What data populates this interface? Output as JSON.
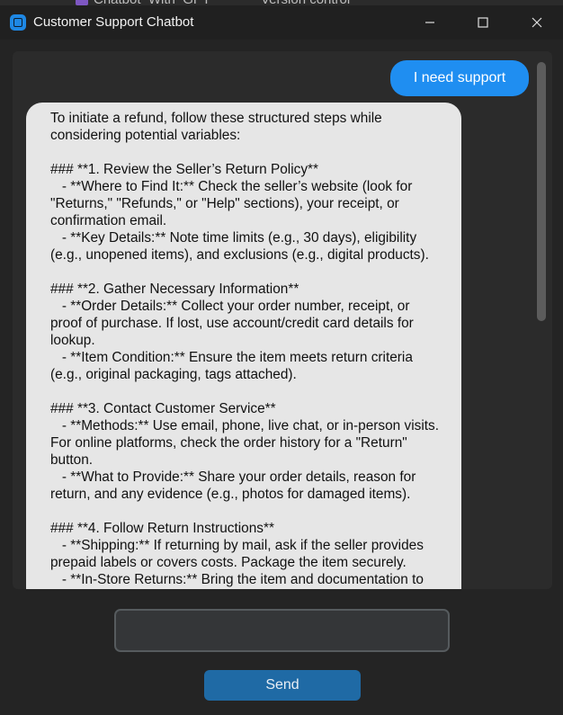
{
  "background_window": {
    "fragment_left": "Chatbot_With_GPT",
    "fragment_right": "Version control"
  },
  "window": {
    "title": "Customer Support Chatbot",
    "icon": "app-window-icon",
    "controls": {
      "minimize_icon": "minimize-icon",
      "maximize_icon": "maximize-icon",
      "close_icon": "close-icon"
    }
  },
  "chat": {
    "user_message": "I need support",
    "bot_message": "To initiate a refund, follow these structured steps while considering potential variables:\n\n### **1. Review the Seller’s Return Policy**\n   - **Where to Find It:** Check the seller’s website (look for \"Returns,\" \"Refunds,\" or \"Help\" sections), your receipt, or confirmation email.\n   - **Key Details:** Note time limits (e.g., 30 days), eligibility (e.g., unopened items), and exclusions (e.g., digital products).\n\n### **2. Gather Necessary Information**\n   - **Order Details:** Collect your order number, receipt, or proof of purchase. If lost, use account/credit card details for lookup.\n   - **Item Condition:** Ensure the item meets return criteria (e.g., original packaging, tags attached).\n\n### **3. Contact Customer Service**\n   - **Methods:** Use email, phone, live chat, or in-person visits. For online platforms, check the order history for a \"Return\" button.\n   - **What to Provide:** Share your order details, reason for return, and any evidence (e.g., photos for damaged items).\n\n### **4. Follow Return Instructions**\n   - **Shipping:** If returning by mail, ask if the seller provides prepaid labels or covers costs. Package the item securely.\n   - **In-Store Returns:** Bring the item and documentation to"
  },
  "input": {
    "value": "",
    "placeholder": ""
  },
  "send_button": {
    "label": "Send"
  },
  "colors": {
    "user_bubble": "#1f8ef1",
    "bot_bubble": "#e6e6e6",
    "send_button": "#1f6aa5",
    "window_bg": "#242424",
    "chat_bg": "#2b2b2b"
  }
}
